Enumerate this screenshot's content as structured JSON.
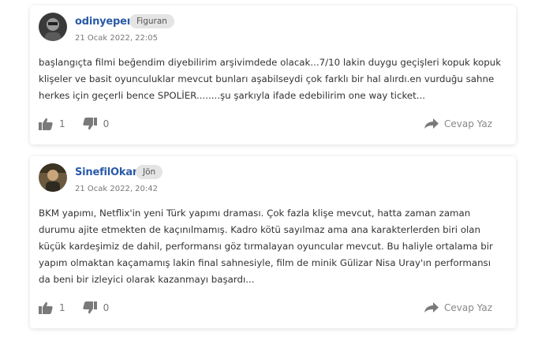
{
  "comments": [
    {
      "username": "odinyeper",
      "badge": "Figuran",
      "date": "21 Ocak 2022, 22:05",
      "text": "başlangıçta filmi beğendim diyebilirim arşivimdede olacak...7/10 lakin duygu geçişleri kopuk kopuk klişeler ve basit oyunculuklar mevcut bunları aşabilseydi çok farklı bir hal alırdı.en vurduğu sahne herkes için geçerli bence SPOLİER........şu şarkıyla ifade edebilirim one way ticket...",
      "likes": "1",
      "dislikes": "0",
      "reply_label": "Cevap Yaz"
    },
    {
      "username": "SinefilOkan",
      "badge": "Jön",
      "date": "21 Ocak 2022, 20:42",
      "text": "BKM yapımı, Netflix'in yeni Türk yapımı draması. Çok fazla klişe mevcut, hatta zaman zaman durumu ajite etmekten de kaçınılmamış. Kadro kötü sayılmaz ama ana karakterlerden biri olan küçük kardeşimiz de dahil, performansı göz tırmalayan oyuncular mevcut. Bu haliyle ortalama bir yapım olmaktan kaçamamış lakin final sahnesiyle, film de minik Gülizar Nisa Uray'ın performansı da beni bir izleyici olarak kazanmayı başardı...",
      "likes": "1",
      "dislikes": "0",
      "reply_label": "Cevap Yaz"
    }
  ],
  "icons": {
    "like": "thumbs-up-icon",
    "dislike": "thumbs-down-icon",
    "reply": "reply-arrow-icon"
  },
  "colors": {
    "username": "#2a5aa8",
    "icon": "#7a7a7a",
    "badge_bg": "#e4e4e4"
  }
}
